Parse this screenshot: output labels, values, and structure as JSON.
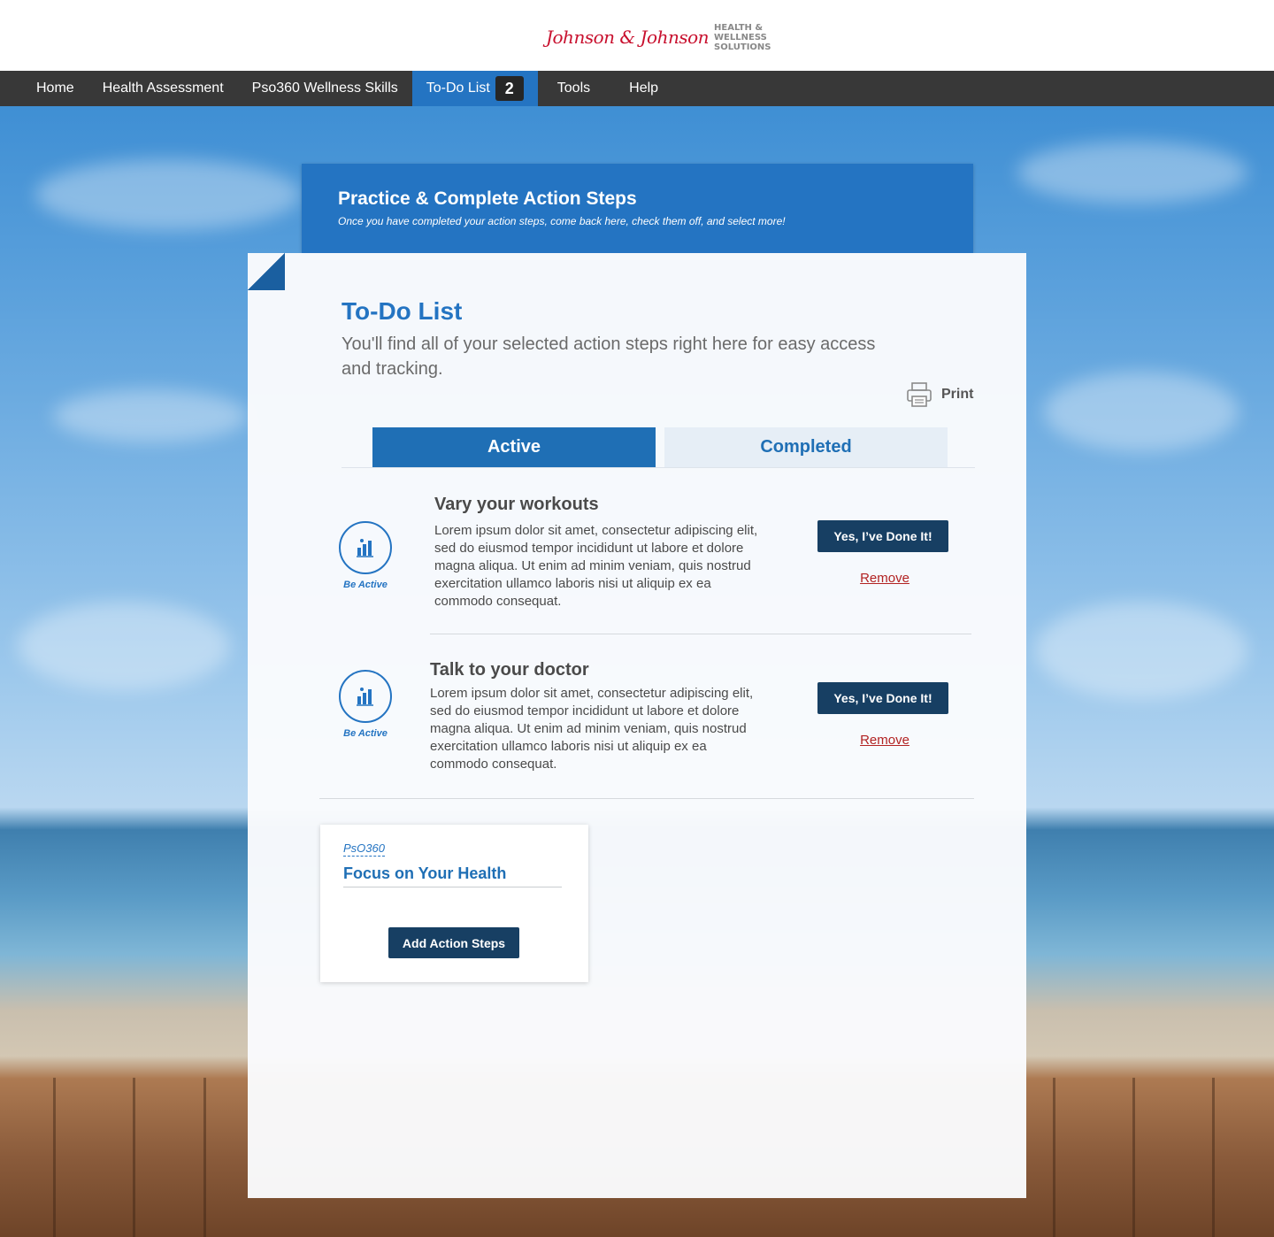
{
  "brand": {
    "script": "Johnson & Johnson",
    "lines": [
      "HEALTH &",
      "WELLNESS",
      "SOLUTIONS"
    ]
  },
  "nav": {
    "home": "Home",
    "health_assessment": "Health Assessment",
    "wellness_skills": "Pso360 Wellness Skills",
    "todo": "To-Do List",
    "todo_count": "2",
    "tools": "Tools",
    "help": "Help"
  },
  "hero": {
    "title": "Practice & Complete Action Steps",
    "subtitle": "Once you have completed your action steps, come back here, check them off, and select more!"
  },
  "page": {
    "title": "To-Do List",
    "subtitle": "You'll find all of your selected action steps right here for easy access and tracking.",
    "print_label": "Print"
  },
  "tabs": {
    "active": "Active",
    "completed": "Completed"
  },
  "items": [
    {
      "icon_label": "Be Active",
      "title": "Vary your workouts",
      "description": "Lorem ipsum dolor sit amet, consectetur adipiscing elit, sed do eiusmod tempor incididunt ut labore et dolore magna aliqua. Ut enim ad minim veniam, quis nostrud exercitation ullamco laboris nisi ut aliquip ex ea commodo consequat.",
      "done_label": "Yes, I’ve Done It!",
      "remove_label": "Remove"
    },
    {
      "icon_label": "Be Active",
      "title": "Talk to your doctor",
      "description": "Lorem ipsum dolor sit amet, consectetur adipiscing elit, sed do eiusmod tempor incididunt ut labore et dolore magna aliqua. Ut enim ad minim veniam, quis nostrud exercitation ullamco laboris nisi ut aliquip ex ea commodo consequat.",
      "done_label": "Yes, I’ve Done It!",
      "remove_label": "Remove"
    }
  ],
  "card": {
    "tag": "PsO360",
    "title": "Focus on Your Health",
    "button": "Add Action Steps"
  },
  "icons": {
    "item_icon": "activity-chart-icon",
    "print_icon": "printer-icon"
  },
  "colors": {
    "primary_blue": "#2474c2",
    "dark_navy": "#173f63",
    "nav_bg": "#383838",
    "remove_red": "#b22222",
    "brand_red": "#c8102e"
  }
}
